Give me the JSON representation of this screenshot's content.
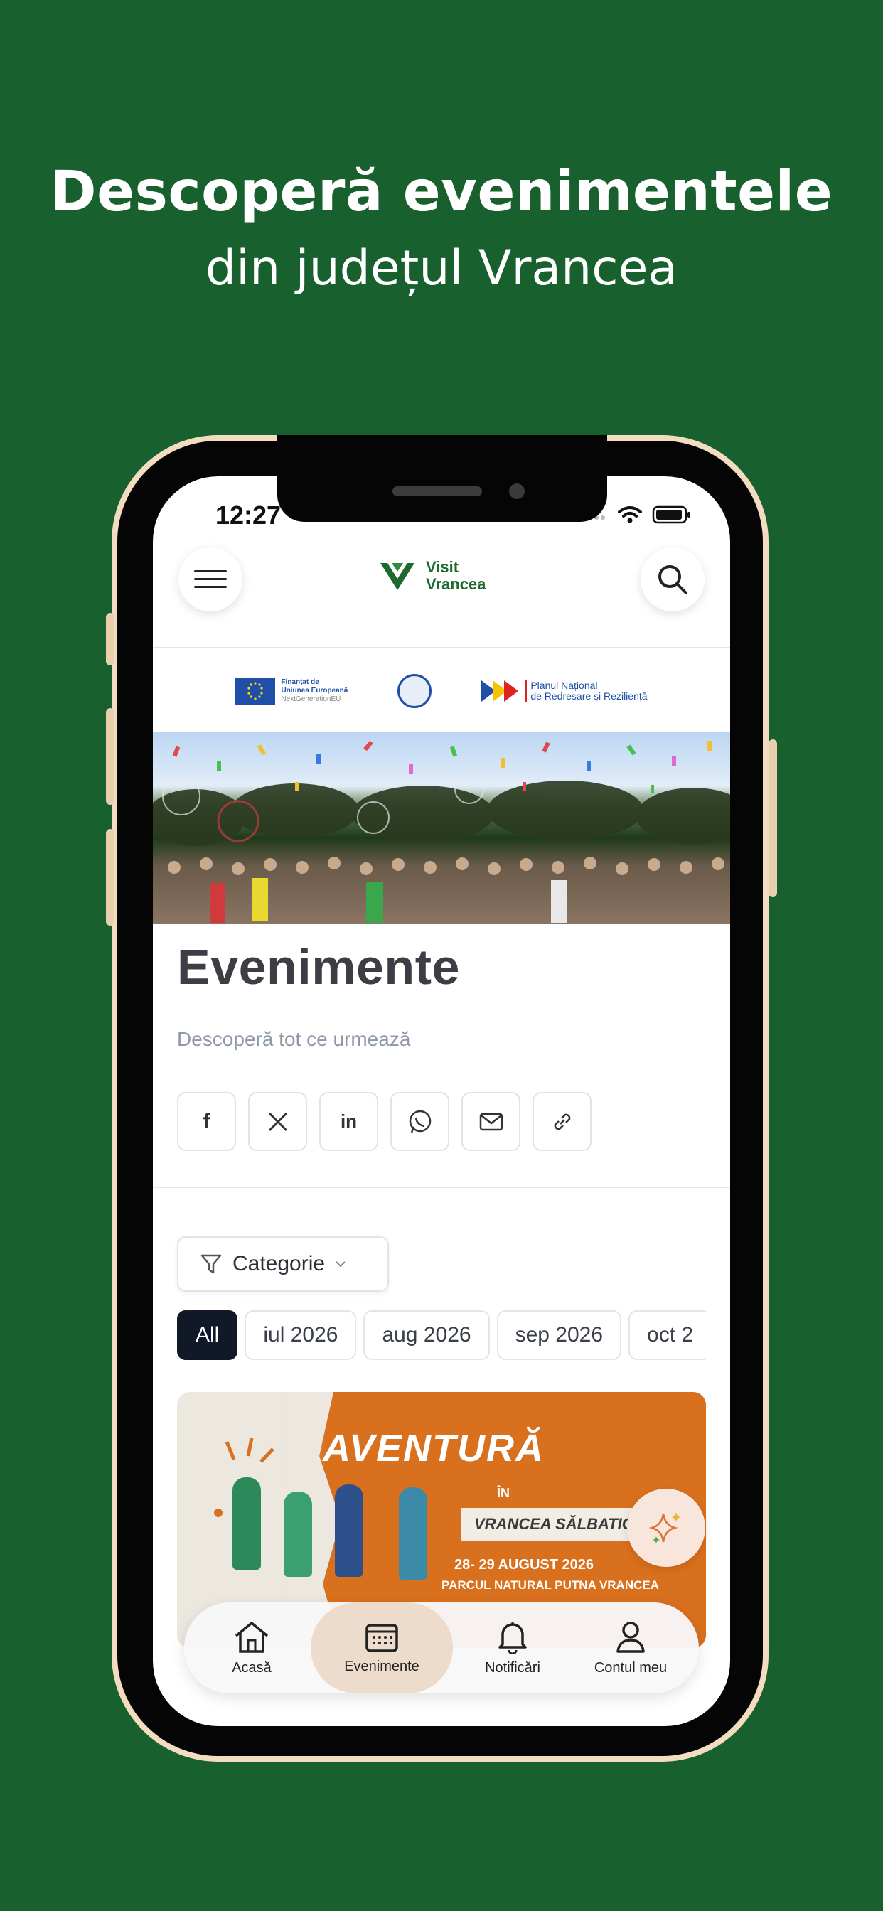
{
  "promo": {
    "title": "Descoperă evenimentele",
    "subtitle": "din județul Vrancea"
  },
  "status_bar": {
    "time": "12:27"
  },
  "header": {
    "logo_line1": "Visit",
    "logo_line2": "Vrancea"
  },
  "funding": {
    "eu_line1": "Finanțat de",
    "eu_line2": "Uniunea Europeană",
    "eu_line3": "NextGenerationEU",
    "pnrr_line1": "Planul Național",
    "pnrr_line2": "de Redresare și Reziliență"
  },
  "page": {
    "title": "Evenimente",
    "subtitle": "Descoperă tot ce urmează"
  },
  "share": {
    "icons": [
      "facebook-icon",
      "x-icon",
      "linkedin-icon",
      "whatsapp-icon",
      "mail-icon",
      "link-icon"
    ]
  },
  "filters": {
    "category_label": "Categorie",
    "months": [
      "All",
      "iul 2026",
      "aug 2026",
      "sep 2026",
      "oct 2"
    ]
  },
  "event": {
    "title": "AVENTURĂ",
    "in": "ÎN",
    "tag": "VRANCEA SĂLBATICĂ",
    "date": "28- 29 AUGUST 2026",
    "place": "PARCUL NATURAL PUTNA VRANCEA"
  },
  "tabbar": {
    "items": [
      {
        "label": "Acasă",
        "icon": "home-icon"
      },
      {
        "label": "Evenimente",
        "icon": "calendar-icon"
      },
      {
        "label": "Notificări",
        "icon": "bell-icon"
      },
      {
        "label": "Contul meu",
        "icon": "user-icon"
      }
    ]
  },
  "colors": {
    "background": "#18602d",
    "brand_green": "#1e6a2e",
    "active_chip": "#111827",
    "event_orange": "#d9701e"
  }
}
